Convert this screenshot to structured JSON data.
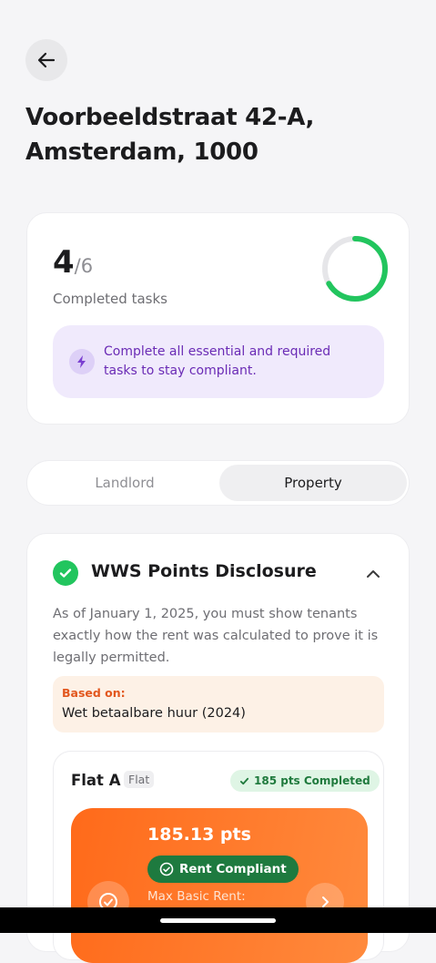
{
  "header": {
    "back_icon": "arrow-left-icon",
    "title": "Voorbeeldstraat 42-A, Amsterdam, 1000"
  },
  "progress": {
    "completed": "4",
    "total": "/6",
    "label": "Completed tasks",
    "fraction": 0.6667,
    "ring_color": "#22c55e",
    "notice_icon": "lightning-icon",
    "notice": "Complete all essential and required tasks to stay compliant."
  },
  "tabs": [
    {
      "label": "Landlord",
      "selected": false
    },
    {
      "label": "Property",
      "selected": true
    }
  ],
  "wws": {
    "status_icon": "check-circle-icon",
    "title": "WWS Points Disclosure",
    "chevron_icon": "chevron-up-icon",
    "description": "As of January 1, 2025, you must show tenants exactly how the rent was calculated to prove it is legally permitted.",
    "based_on_label": "Based on:",
    "based_on_value": "Wet betaalbare huur (2024)",
    "unit": {
      "name": "Flat A",
      "type": "Flat",
      "points_badge": "185 pts Completed",
      "points": "185.13 pts",
      "compliance": "Rent Compliant",
      "max_rent_label": "Max Basic Rent:"
    }
  },
  "colors": {
    "accent_green": "#22c55e",
    "notice_purple": "#6a2bb5",
    "orange": "#ff6a1a"
  }
}
